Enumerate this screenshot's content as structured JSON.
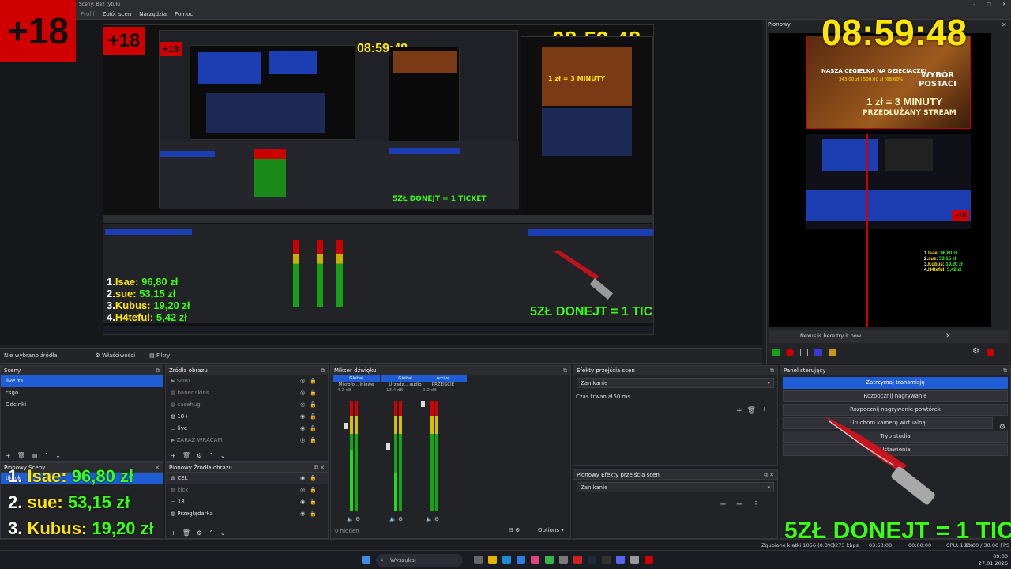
{
  "window": {
    "title": "Sceny: Bez tytułu"
  },
  "menu": [
    "Profil",
    "Zbiór scen",
    "Narzędzia",
    "Pomoc"
  ],
  "overlay": {
    "age_badge": "+18",
    "clock": "08:59:48",
    "donation_list": [
      {
        "rank": "1.",
        "name": "Isae:",
        "amount": "96,80 zł"
      },
      {
        "rank": "2.",
        "name": "sue:",
        "amount": "53,15 zł"
      },
      {
        "rank": "3.",
        "name": "Kubus:",
        "amount": "19,20 zł"
      },
      {
        "rank": "4.",
        "name": "H4teful:",
        "amount": "5,42 zł"
      }
    ],
    "ticket_text": "5ZŁ DONEJT = 1 TICKET",
    "banner_title": "NASZA CEGIEŁKA NA DZIECIACZKI",
    "banner_amount": "343,00 zł | 500,00 zł (68.60%)",
    "banner_choice": "WYBÓR POSTACI",
    "banner_minutes": "1 zł = 3 MINUTY",
    "banner_stream": "PRZEDŁUŻANY STREAM",
    "small_ticket": "5ZŁ DONEJT = 1 TICKET"
  },
  "vertical": {
    "title": "Pionowy",
    "nexus_text": "Nexus is here try it now",
    "nexus_close": "×"
  },
  "status_strip": {
    "no_source": "Nie wybrano źródła",
    "properties": "Właściwości",
    "filters": "Filtry"
  },
  "scenes": {
    "title": "Sceny",
    "items": [
      {
        "label": "live YT",
        "selected": true
      },
      {
        "label": "csgo",
        "selected": false
      },
      {
        "label": "Odcinki",
        "selected": false
      }
    ]
  },
  "vertical_scenes": {
    "title": "Pionowy Sceny",
    "items": [
      {
        "label": "tiktok",
        "selected": true
      }
    ]
  },
  "sources": {
    "title": "Źródła obrazu",
    "items": [
      {
        "label": "SUBY",
        "dim": true
      },
      {
        "label": "baner skins",
        "dim": true
      },
      {
        "label": "casehug",
        "dim": true
      },
      {
        "label": "18+",
        "dim": false
      },
      {
        "label": "live",
        "dim": false
      },
      {
        "label": "ZARAZ WRACAM",
        "dim": true
      }
    ]
  },
  "vertical_sources": {
    "title": "Pionowy Źródła obrazu",
    "items": [
      {
        "label": "CEL",
        "dim": false
      },
      {
        "label": "kick",
        "dim": true
      },
      {
        "label": "18",
        "dim": false
      },
      {
        "label": "Przeglądarka",
        "dim": false
      }
    ]
  },
  "mixer": {
    "title": "Mikser dźwięku",
    "channels": [
      {
        "tag": "Global",
        "name": "Mikrofo...liniowe",
        "db": "-4.2 dB",
        "level": 0.55
      },
      {
        "tag": "Global",
        "name": "Urządz... audio",
        "db": "-13.4 dB",
        "level": 0.35
      },
      {
        "tag": "Active",
        "name": "PRZEJŚCIE",
        "db": "0.0 dB",
        "level": 0.0
      }
    ],
    "hidden": "0 hidden",
    "options": "Options"
  },
  "transitions": {
    "title": "Efekty przejścia scen",
    "selected": "Zanikanie",
    "duration_label": "Czas trwania",
    "duration_value": "150 ms"
  },
  "vertical_transitions": {
    "title": "Pionowy Efekty przejścia scen",
    "selected": "Zanikanie"
  },
  "controls": {
    "title": "Panel sterujący",
    "buttons": [
      {
        "label": "Zatrzymaj transmisję",
        "primary": true
      },
      {
        "label": "Rozpocznij nagrywanie",
        "primary": false
      },
      {
        "label": "Rozpocznij nagrywanie powtórek",
        "primary": false
      },
      {
        "label": "Uruchom kamerę wirtualną",
        "primary": false
      },
      {
        "label": "Tryb studia",
        "primary": false
      },
      {
        "label": "Ustawienia",
        "primary": false
      }
    ]
  },
  "statusbar": {
    "dropped": "Zgubione klatki 1056 (0.3%)",
    "bitrate": "3273 kbps",
    "live_time": "03:53:08",
    "rec_time": "00:00:00",
    "cpu": "CPU: 1.6%",
    "fps": "30.00 / 30.00 FPS"
  },
  "taskbar": {
    "search": "Wyszukaj",
    "time": "09:00",
    "date": "27.01.2026"
  }
}
